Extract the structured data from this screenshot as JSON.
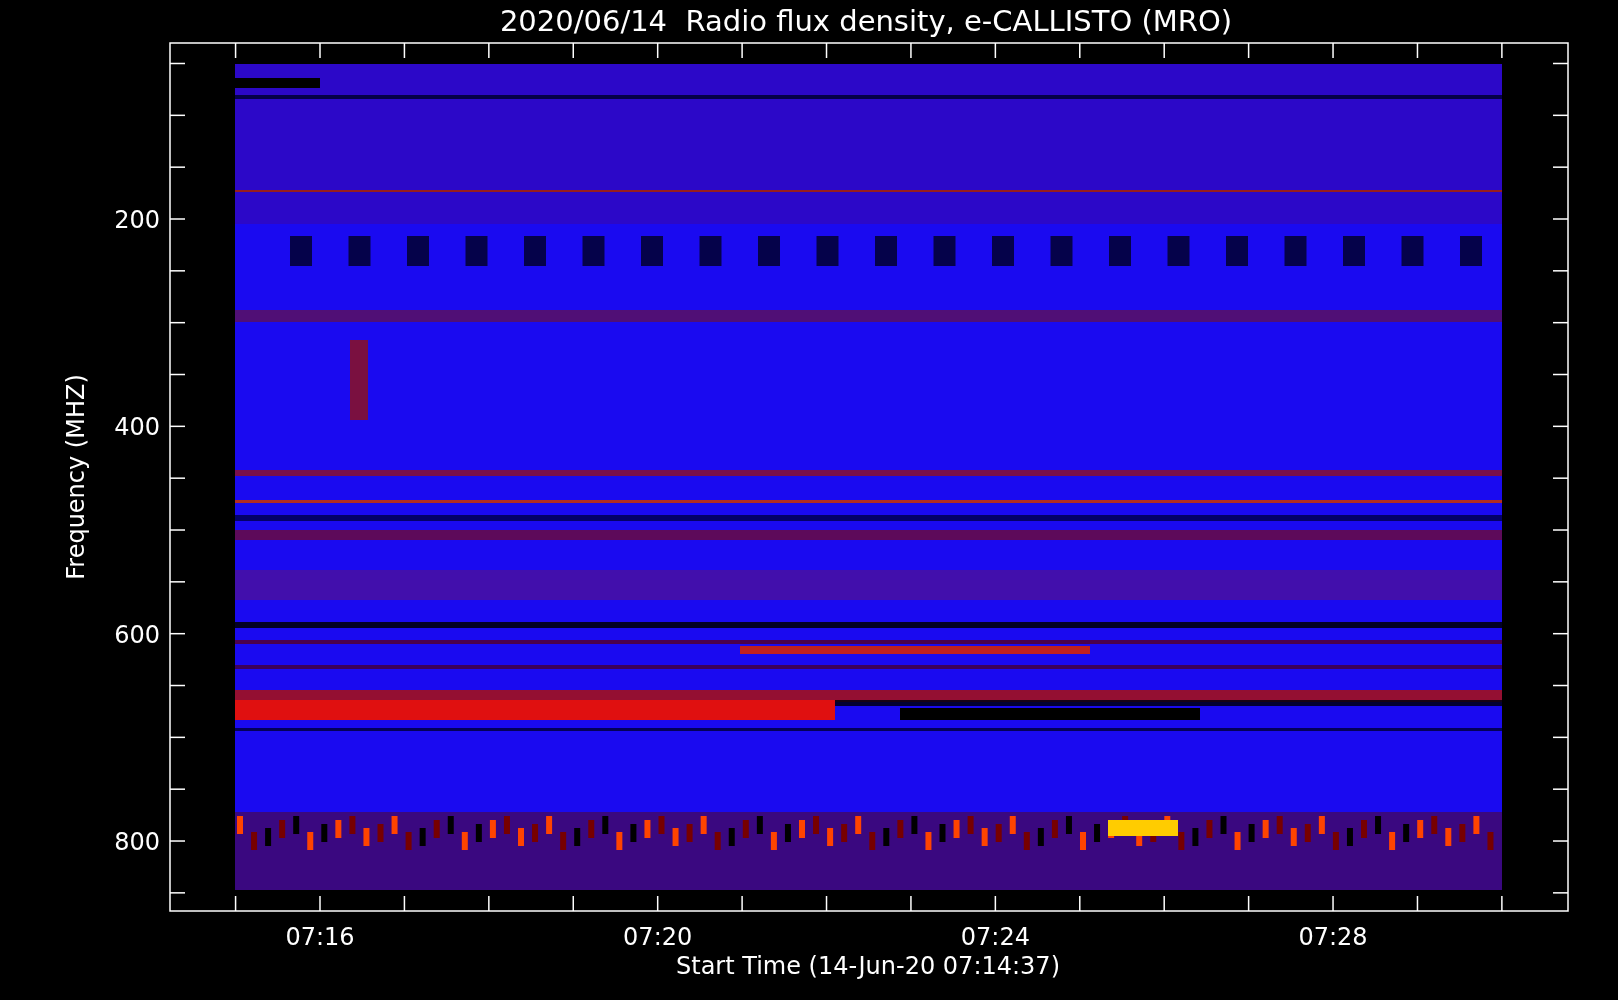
{
  "title": "2020/06/14  Radio flux density, e-CALLISTO (MRO)",
  "y_axis": {
    "label": "Frequency (MHZ)",
    "tick_labels": [
      "200",
      "400",
      "600",
      "800"
    ]
  },
  "x_axis": {
    "label": "Start Time (14-Jun-20 07:14:37)",
    "tick_labels": [
      "07:16",
      "07:20",
      "07:24",
      "07:28"
    ]
  }
}
